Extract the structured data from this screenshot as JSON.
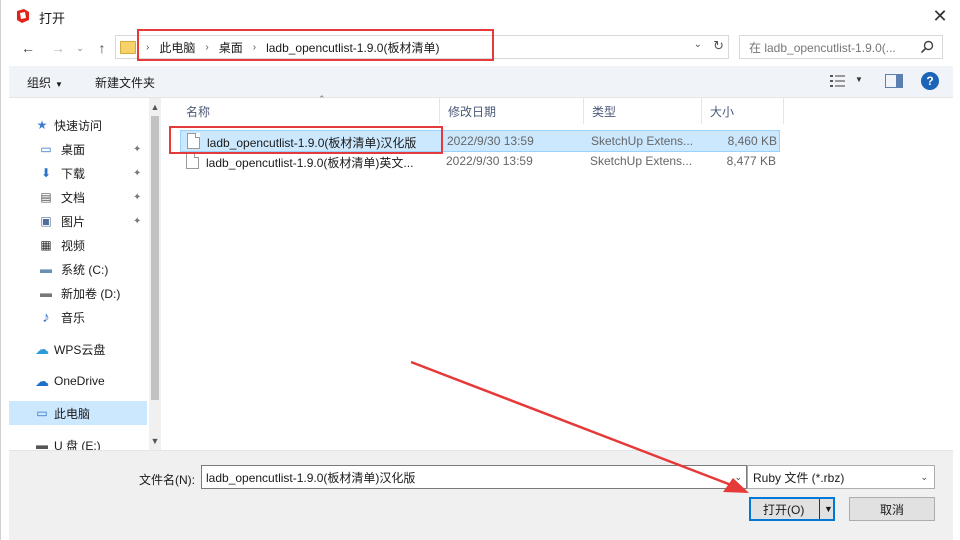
{
  "window": {
    "title": "打开",
    "close_glyph": "✕"
  },
  "navigation": {
    "back_glyph": "←",
    "forward_glyph": "→",
    "recent_glyph": "⌄",
    "up_glyph": "↑",
    "breadcrumb": [
      "此电脑",
      "桌面",
      "ladb_opencutlist-1.9.0(板材清单)"
    ],
    "dropdown_glyph": "⌄",
    "refresh_glyph": "↻",
    "search_placeholder": "在 ladb_opencutlist-1.9.0(..."
  },
  "toolbar": {
    "organize_label": "组织",
    "organize_caret": "▼",
    "new_folder_label": "新建文件夹",
    "view_caret": "▼",
    "help_glyph": "?"
  },
  "sidebar": {
    "items": [
      {
        "label": "快速访问",
        "icon": "star-icon",
        "glyph": "★",
        "pinned": false
      },
      {
        "label": "桌面",
        "icon": "desktop-icon",
        "glyph": "▭",
        "pinned": true
      },
      {
        "label": "下载",
        "icon": "download-icon",
        "glyph": "⬇",
        "pinned": true
      },
      {
        "label": "文档",
        "icon": "document-icon",
        "glyph": "▤",
        "pinned": true
      },
      {
        "label": "图片",
        "icon": "picture-icon",
        "glyph": "▣",
        "pinned": true
      },
      {
        "label": "视频",
        "icon": "video-icon",
        "glyph": "▦",
        "pinned": false
      },
      {
        "label": "系统 (C:)",
        "icon": "drive-icon",
        "glyph": "▬",
        "pinned": false
      },
      {
        "label": "新加卷 (D:)",
        "icon": "drive-icon",
        "glyph": "▬",
        "pinned": false
      },
      {
        "label": "音乐",
        "icon": "music-icon",
        "glyph": "♪",
        "pinned": false
      },
      {
        "label": "WPS云盘",
        "icon": "cloud-icon",
        "glyph": "☁",
        "pinned": false
      },
      {
        "label": "OneDrive",
        "icon": "onedrive-icon",
        "glyph": "☁",
        "pinned": false
      },
      {
        "label": "此电脑",
        "icon": "computer-icon",
        "glyph": "▭",
        "pinned": false,
        "selected": true
      },
      {
        "label": "U 盘 (E:)",
        "icon": "usb-drive-icon",
        "glyph": "▬",
        "pinned": false
      }
    ],
    "pin_glyph": "📌",
    "scroll_up_glyph": "▲",
    "scroll_down_glyph": "▼"
  },
  "file_list": {
    "columns": [
      "名称",
      "修改日期",
      "类型",
      "大小"
    ],
    "sort_glyph": "⌃",
    "rows": [
      {
        "name": "ladb_opencutlist-1.9.0(板材清单)汉化版",
        "date": "2022/9/30 13:59",
        "type": "SketchUp Extens...",
        "size": "8,460 KB",
        "selected": true
      },
      {
        "name": "ladb_opencutlist-1.9.0(板材清单)英文...",
        "date": "2022/9/30 13:59",
        "type": "SketchUp Extens...",
        "size": "8,477 KB",
        "selected": false
      }
    ]
  },
  "footer": {
    "filename_label": "文件名(N):",
    "filename_value": "ladb_opencutlist-1.9.0(板材清单)汉化版",
    "filter_value": "Ruby 文件 (*.rbz)",
    "dropdown_glyph": "⌄",
    "open_label": "打开(O)",
    "open_caret": "▼",
    "cancel_label": "取消"
  },
  "colors": {
    "annotation_red": "#e63a3a",
    "selection_blue": "#cce8ff",
    "accent_blue": "#0078d7"
  }
}
